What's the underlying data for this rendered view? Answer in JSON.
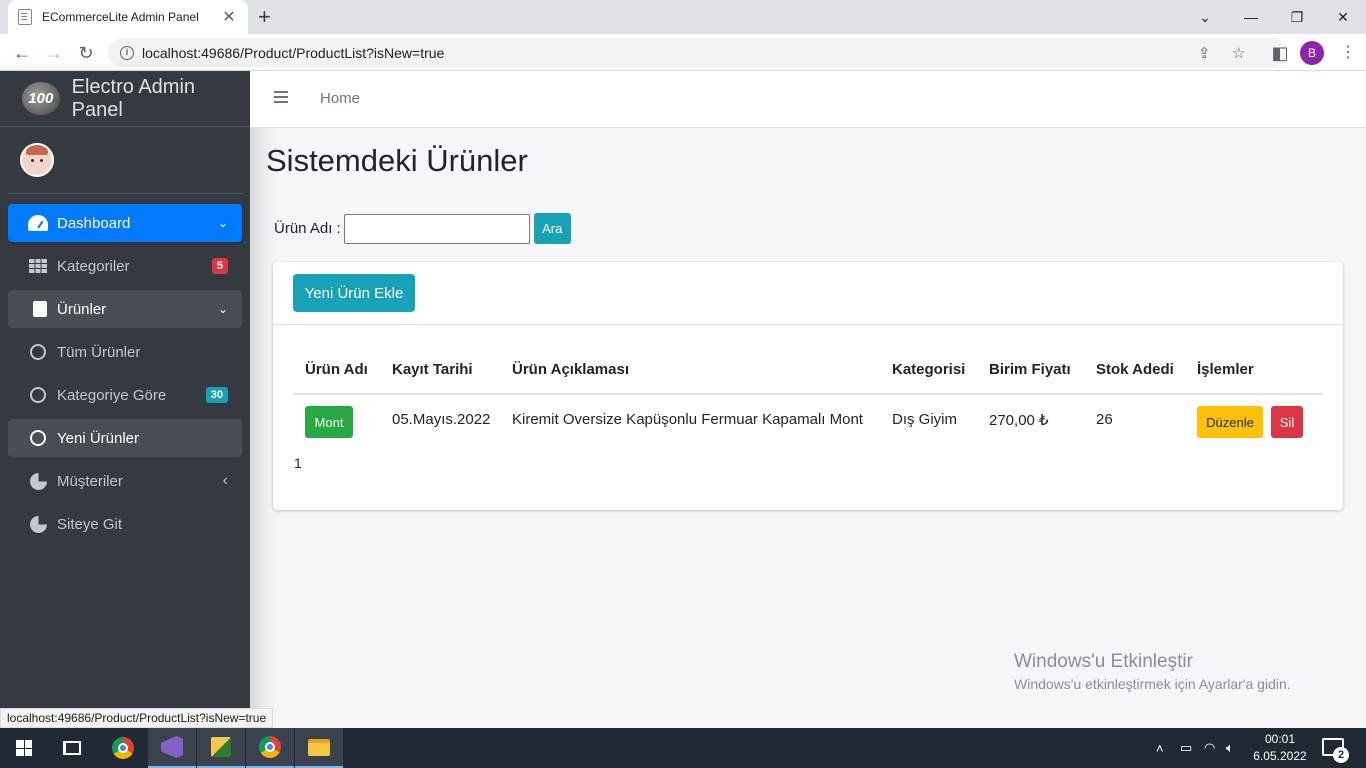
{
  "browser": {
    "tab_title": "ECommerceLite Admin Panel",
    "tab_close": "✕",
    "new_tab": "+",
    "url": "localhost:49686/Product/ProductList?isNew=true",
    "profile_initial": "B",
    "status_url": "localhost:49686/Product/ProductList?isNew=true"
  },
  "sidebar": {
    "brand_logo": "100",
    "brand_name": "Electro Admin Panel",
    "items": [
      {
        "label": "Dashboard",
        "icon": "gauge-icon"
      },
      {
        "label": "Kategoriler",
        "icon": "grid-icon",
        "badge": "5",
        "badge_color": "#dc3545"
      },
      {
        "label": "Ürünler",
        "icon": "copy-icon"
      },
      {
        "label": "Tüm Ürünler",
        "icon": "circle-icon"
      },
      {
        "label": "Kategoriye Göre",
        "icon": "circle-icon",
        "badge": "30",
        "badge_color": "#17a2b8"
      },
      {
        "label": "Yeni Ürünler",
        "icon": "circle-icon"
      },
      {
        "label": "Müşteriler",
        "icon": "pie-chart-icon"
      },
      {
        "label": "Siteye Git",
        "icon": "pie-chart-icon"
      }
    ]
  },
  "topnav": {
    "home": "Home"
  },
  "main": {
    "title": "Sistemdeki Ürünler",
    "search_label": "Ürün Adı :",
    "search_value": "",
    "search_button": "Ara",
    "add_button": "Yeni Ürün Ekle",
    "columns": [
      "Ürün Adı",
      "Kayıt Tarihi",
      "Ürün Açıklaması",
      "Kategorisi",
      "Birim Fiyatı",
      "Stok Adedi",
      "İşlemler"
    ],
    "rows": [
      {
        "name": "Mont",
        "date": "05.Mayıs.2022",
        "description": "Kiremit Oversize Kapüşonlu Fermuar Kapamalı Mont",
        "category": "Dış Giyim",
        "price": "270,00 ₺",
        "stock": "26",
        "edit_label": "Düzenle",
        "delete_label": "Sil"
      }
    ],
    "page": "1"
  },
  "watermark": {
    "line1": "Windows'u Etkinleştir",
    "line2": "Windows'u etkinleştirmek için Ayarlar'a gidin."
  },
  "taskbar": {
    "time": "00:01",
    "date": "6.05.2022",
    "notifications": "2"
  },
  "colors": {
    "primary": "#007bff",
    "info": "#17a2b8",
    "success": "#28a745",
    "warning": "#ffc107",
    "danger": "#dc3545",
    "sidebar_bg": "#343a40"
  }
}
